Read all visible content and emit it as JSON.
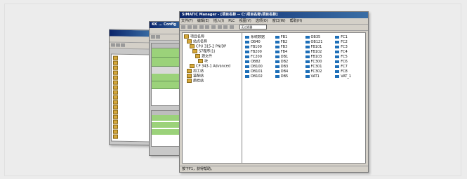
{
  "windows": {
    "back": {
      "items": [
        "",
        "",
        "",
        "",
        "",
        "",
        "",
        "",
        "",
        "",
        "",
        "",
        "",
        "",
        "",
        "",
        ""
      ]
    },
    "middle": {
      "title": "KK ... Config"
    },
    "front": {
      "title": "SIMATIC Manager - [项目名称 -- C:\\项目名称\\项目名称]",
      "menu": [
        "文件(F)",
        "编辑(E)",
        "插入(I)",
        "PLC",
        "视图(V)",
        "选项(O)",
        "窗口(W)",
        "帮助(H)"
      ],
      "search_placeholder": "无过滤器",
      "tree": [
        "项目名称",
        "站点名称",
        "CPU 315-2 PN/DP",
        "S7程序(1)",
        "源文件",
        "块",
        "CP 343-1 Advanced",
        "加工站",
        "装配站",
        "质检站"
      ],
      "list": [
        "系统数据",
        "FB1",
        "OB35",
        "FC1",
        "OB40",
        "FB2",
        "OB121",
        "FC2",
        "FB100",
        "FB3",
        "FB101",
        "FC3",
        "FB200",
        "FB4",
        "FB102",
        "FC4",
        "FC200",
        "DB1",
        "FB103",
        "FC5",
        "OB82",
        "DB2",
        "FC300",
        "FC6",
        "DB100",
        "DB3",
        "FC301",
        "FC7",
        "DB101",
        "DB4",
        "FC302",
        "FC8",
        "DB102",
        "DB5",
        "VAT1",
        "VAT_1"
      ],
      "status": "按下F1，获得帮助。"
    }
  }
}
